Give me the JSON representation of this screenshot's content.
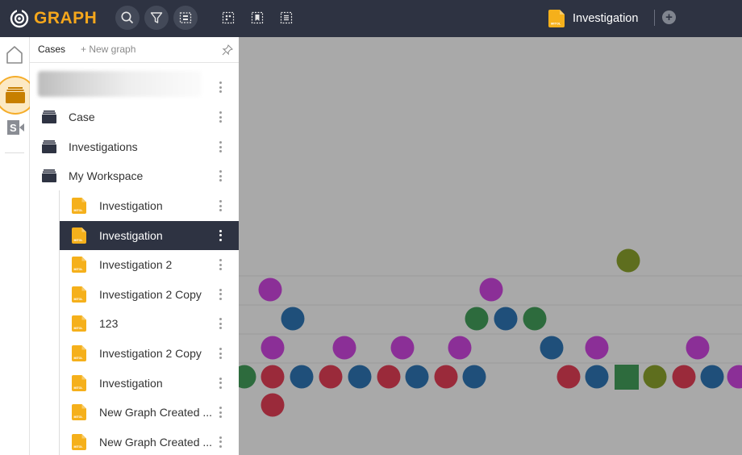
{
  "app": {
    "logo_text": "GRAPH",
    "brand_color": "#f5a71c",
    "topbar_color": "#2e3342"
  },
  "toolbar": {
    "buttons": [
      "search-icon",
      "filter-icon",
      "layout-icon",
      "select-all-icon",
      "bookmark-select-icon",
      "list-select-icon"
    ]
  },
  "graph": {
    "title": "Investigation",
    "file_icon_label": "MITOL"
  },
  "panel": {
    "tab_cases": "Cases",
    "tab_new_graph": "+ New graph",
    "folders": [
      {
        "label": "Case"
      },
      {
        "label": "Investigations"
      },
      {
        "label": "My Workspace"
      }
    ],
    "items": [
      {
        "label": "Investigation",
        "selected": false
      },
      {
        "label": "Investigation",
        "selected": true
      },
      {
        "label": "Investigation 2",
        "selected": false
      },
      {
        "label": "Investigation 2 Copy",
        "selected": false
      },
      {
        "label": "123",
        "selected": false
      },
      {
        "label": "Investigation 2 Copy",
        "selected": false
      },
      {
        "label": "Investigation",
        "selected": false
      },
      {
        "label": "New Graph Created ...",
        "selected": false
      },
      {
        "label": "New Graph Created ...",
        "selected": false
      }
    ]
  },
  "colors": {
    "purple": "#8b2f97",
    "blue": "#1f4f7a",
    "green": "#2d6b3d",
    "red": "#9a2a3a",
    "olive": "#5e6e1e",
    "canvas_bg": "#a9a9a9"
  }
}
